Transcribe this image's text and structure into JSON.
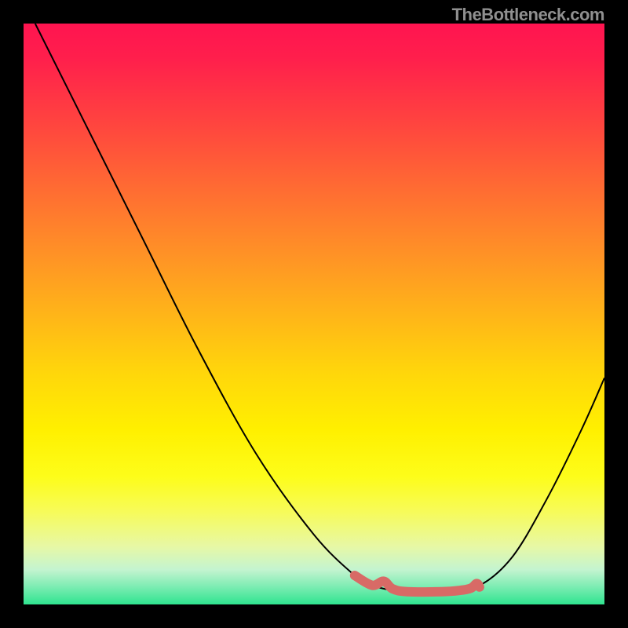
{
  "attribution": "TheBottleneck.com",
  "chart_data": {
    "type": "line",
    "title": "",
    "xlabel": "",
    "ylabel": "",
    "xlim": [
      0,
      100
    ],
    "ylim": [
      0,
      100
    ],
    "series": [
      {
        "name": "bottleneck-curve",
        "x": [
          2,
          10,
          20,
          30,
          40,
          50,
          57,
          60,
          63,
          66,
          72,
          78,
          84,
          90,
          96,
          100
        ],
        "y": [
          100,
          84,
          64,
          44,
          26,
          12,
          5,
          3.3,
          2.5,
          2.2,
          2.2,
          3,
          8,
          18,
          30,
          39
        ]
      }
    ],
    "highlight_segment": {
      "name": "bottom-bumps",
      "x": [
        57,
        60,
        62,
        63.5,
        66,
        72,
        75,
        77,
        78,
        78.5
      ],
      "y": [
        5,
        3.3,
        4.0,
        2.7,
        2.2,
        2.2,
        2.4,
        2.8,
        3.6,
        3.0
      ]
    },
    "gradient_stops": [
      {
        "pct": 0,
        "color": "#ff1450"
      },
      {
        "pct": 18,
        "color": "#ff473e"
      },
      {
        "pct": 38,
        "color": "#ff8c28"
      },
      {
        "pct": 60,
        "color": "#ffd60b"
      },
      {
        "pct": 78,
        "color": "#fdfd1a"
      },
      {
        "pct": 94,
        "color": "#c4f4d0"
      },
      {
        "pct": 100,
        "color": "#2fe48f"
      }
    ]
  }
}
